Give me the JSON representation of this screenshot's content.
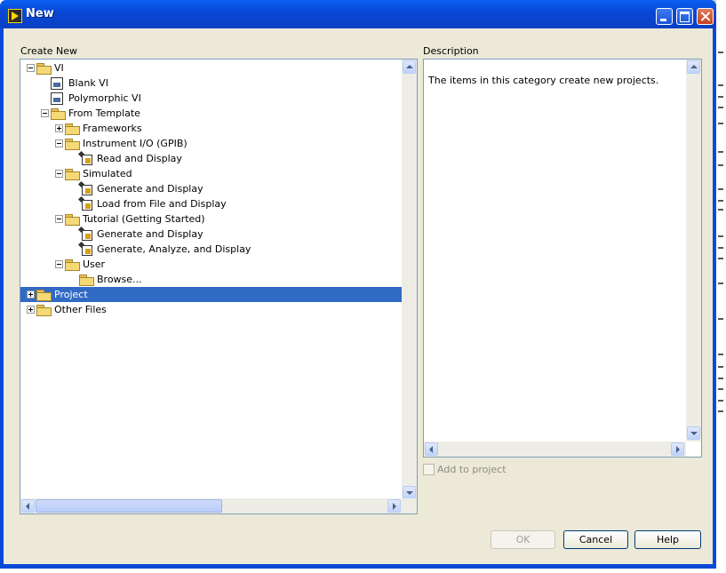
{
  "window": {
    "title": "New",
    "accent": "#0a4ad8",
    "controls": [
      "minimize-icon",
      "maximize-icon",
      "close-icon"
    ]
  },
  "create_new": {
    "label": "Create New",
    "tree": [
      {
        "label": "VI",
        "icon": "folder-icon",
        "expander": "minus"
      },
      {
        "label": "Blank VI",
        "icon": "vi-icon"
      },
      {
        "label": "Polymorphic VI",
        "icon": "vi-icon"
      },
      {
        "label": "From Template",
        "icon": "folder-icon",
        "expander": "minus"
      },
      {
        "label": "Frameworks",
        "icon": "folder-icon",
        "expander": "plus"
      },
      {
        "label": "Instrument I/O (GPIB)",
        "icon": "folder-icon",
        "expander": "minus"
      },
      {
        "label": "Read and Display",
        "icon": "template-icon"
      },
      {
        "label": "Simulated",
        "icon": "folder-icon",
        "expander": "minus"
      },
      {
        "label": "Generate and Display",
        "icon": "template-icon"
      },
      {
        "label": "Load from File and Display",
        "icon": "template-icon"
      },
      {
        "label": "Tutorial (Getting Started)",
        "icon": "folder-icon",
        "expander": "minus"
      },
      {
        "label": "Generate and Display",
        "icon": "template-icon"
      },
      {
        "label": "Generate, Analyze, and Display",
        "icon": "template-icon"
      },
      {
        "label": "User",
        "icon": "folder-icon",
        "expander": "minus"
      },
      {
        "label": "Browse...",
        "icon": "folder-icon"
      },
      {
        "label": "Project",
        "icon": "folder-icon",
        "expander": "plus",
        "selected": true
      },
      {
        "label": "Other Files",
        "icon": "folder-icon",
        "expander": "plus"
      }
    ]
  },
  "description": {
    "label": "Description",
    "text": "The items in this category create new projects."
  },
  "add_to_project": {
    "label": "Add to project",
    "checked": false,
    "enabled": false
  },
  "buttons": {
    "ok": "OK",
    "cancel": "Cancel",
    "help": "Help"
  },
  "colors": {
    "selection": "#316ac5",
    "dialog_face": "#ece9d8"
  }
}
